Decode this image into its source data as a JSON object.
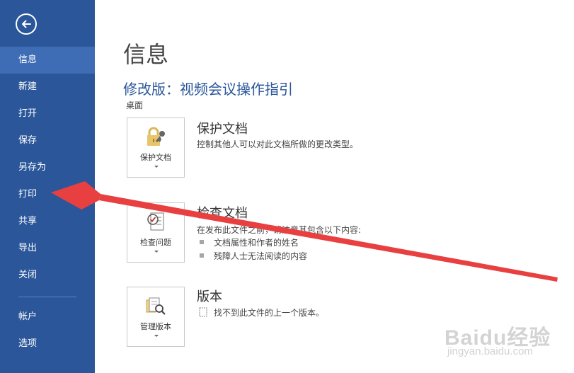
{
  "colors": {
    "sidebar": "#2b579a",
    "sidebar_active": "#3e6db5",
    "accent_title": "#2b579a",
    "annotation_arrow": "#e84040"
  },
  "sidebar": {
    "back_icon": "back-arrow-icon",
    "items": [
      {
        "label": "信息"
      },
      {
        "label": "新建"
      },
      {
        "label": "打开"
      },
      {
        "label": "保存"
      },
      {
        "label": "另存为"
      },
      {
        "label": "打印"
      },
      {
        "label": "共享"
      },
      {
        "label": "导出"
      },
      {
        "label": "关闭"
      },
      {
        "label": "帐户"
      },
      {
        "label": "选项"
      }
    ],
    "active_index": 0
  },
  "main": {
    "page_title": "信息",
    "doc_title": "修改版：视频会议操作指引",
    "doc_location": "桌面",
    "sections": [
      {
        "button_label": "保护文档",
        "button_icon": "lock-key-icon",
        "heading": "保护文档",
        "description": "控制其他人可以对此文档所做的更改类型。"
      },
      {
        "button_label": "检查问题",
        "button_icon": "inspect-checklist-icon",
        "heading": "检查文档",
        "description": "在发布此文件之前，请注意其包含以下内容:",
        "bullets": [
          "文档属性和作者的姓名",
          "残障人士无法阅读的内容"
        ]
      },
      {
        "button_label": "管理版本",
        "button_icon": "manage-versions-icon",
        "heading": "版本",
        "description": "找不到此文件的上一个版本。"
      }
    ]
  },
  "watermark": {
    "brand": "Baidu经验",
    "url": "jingyan.baidu.com"
  }
}
